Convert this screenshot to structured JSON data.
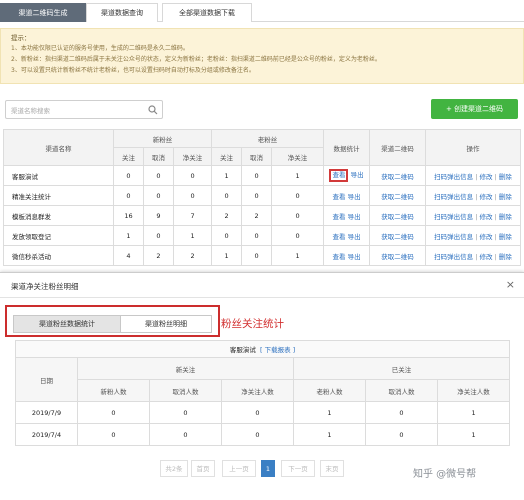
{
  "tabs": [
    "渠道二维码生成",
    "渠道数据查询",
    "全部渠道数据下载"
  ],
  "tips": {
    "title": "提示：",
    "lines": [
      "1、本功能仅限已认证的服务号使用，生成的二维码是永久二维码。",
      "2、新粉丝：指扫渠道二维码后属于未关注公众号的状态，定义为新粉丝；老粉丝：指扫渠道二维码前已经是公众号的粉丝，定义为老粉丝。",
      "3、可以设置只统计新粉丝不统计老粉丝，也可以设置扫码时自动打标及分组或修改备注名。"
    ]
  },
  "search": {
    "placeholder": "渠道名称搜索"
  },
  "create_button": "+ 创建渠道二维码",
  "main_table": {
    "headers": {
      "name": "渠道名称",
      "new_fans": "新粉丝",
      "old_fans": "老粉丝",
      "stats": "数据统计",
      "qrcode": "渠道二维码",
      "ops": "操作",
      "follow": "关注",
      "cancel": "取消",
      "net": "净关注"
    },
    "rows": [
      {
        "name": "客服演试",
        "n_follow": "0",
        "n_cancel": "0",
        "n_net": "0",
        "o_follow": "1",
        "o_cancel": "0",
        "o_net": "1"
      },
      {
        "name": "精准关注统计",
        "n_follow": "0",
        "n_cancel": "0",
        "n_net": "0",
        "o_follow": "0",
        "o_cancel": "0",
        "o_net": "0"
      },
      {
        "name": "模板消息群发",
        "n_follow": "16",
        "n_cancel": "9",
        "n_net": "7",
        "o_follow": "2",
        "o_cancel": "2",
        "o_net": "0"
      },
      {
        "name": "发放领取登记",
        "n_follow": "1",
        "n_cancel": "0",
        "n_net": "1",
        "o_follow": "0",
        "o_cancel": "0",
        "o_net": "0"
      },
      {
        "name": "微信秒杀活动",
        "n_follow": "4",
        "n_cancel": "2",
        "n_net": "2",
        "o_follow": "1",
        "o_cancel": "0",
        "o_net": "1"
      }
    ],
    "view": "查看",
    "export": "导出",
    "get_qr": "获取二维码",
    "scan_info": "扫码弹出信息",
    "edit": "修改",
    "delete": "删除",
    "separator": "|"
  },
  "modal": {
    "title": "渠道净关注粉丝明细",
    "close": "×",
    "sub_tabs": [
      "渠道粉丝数据统计",
      "渠道粉丝明细"
    ],
    "annotation": "粉丝关注统计",
    "detail": {
      "caption_name": "客服演试",
      "download_link": "[ 下载报表 ]",
      "date": "日期",
      "new_follow": "新关注",
      "already_follow": "已关注",
      "sub_headers": [
        "新粉人数",
        "取消人数",
        "净关注人数",
        "老粉人数",
        "取消人数",
        "净关注人数"
      ],
      "rows": [
        {
          "date": "2019/7/9",
          "values": [
            "0",
            "0",
            "0",
            "1",
            "0",
            "1"
          ]
        },
        {
          "date": "2019/7/4",
          "values": [
            "0",
            "0",
            "0",
            "1",
            "0",
            "1"
          ]
        }
      ]
    },
    "pager": {
      "total": "共2条",
      "first": "首页",
      "prev": "上一页",
      "current": "1",
      "next": "下一页",
      "last": "末页"
    }
  },
  "watermark": "知乎 @微号帮",
  "colors": {
    "accent_green": "#42b441",
    "highlight_red": "#d23a3a",
    "link_blue": "#2a6fbf",
    "active_tab": "#5f6b79"
  }
}
